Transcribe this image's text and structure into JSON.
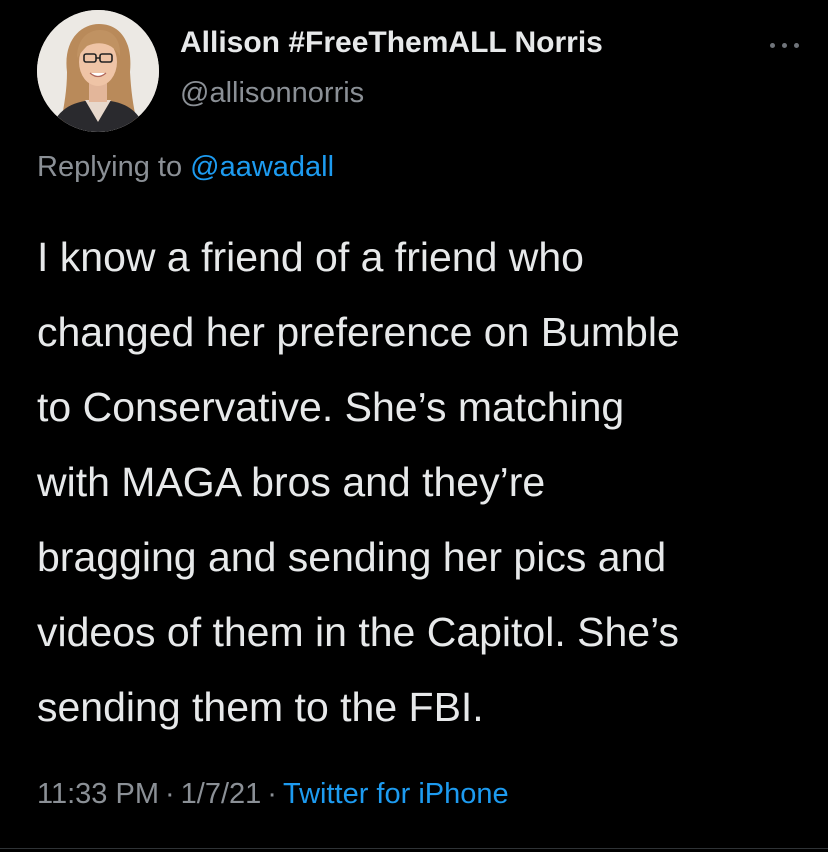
{
  "author": {
    "display_name": "Allison #FreeThemALL Norris",
    "handle": "@allisonnorris"
  },
  "reply": {
    "prefix": "Replying to",
    "handle": "@aawadall"
  },
  "tweet": {
    "lines": [
      "I know a friend of a friend who",
      "changed her preference on Bumble",
      "to Conservative. She’s matching",
      "with MAGA bros and they’re",
      "bragging and sending her pics and",
      "videos of them in the Capitol. She’s",
      "sending them to the FBI."
    ]
  },
  "meta": {
    "time": "11:33 PM",
    "separator": "·",
    "date": "1/7/21",
    "source": "Twitter for iPhone"
  },
  "icons": {
    "more": "more-horizontal-icon",
    "avatar": "profile-photo"
  },
  "colors": {
    "background": "#000000",
    "text": "#e7e9ea",
    "secondary_text": "#8b9096",
    "link": "#1d9bf0"
  }
}
